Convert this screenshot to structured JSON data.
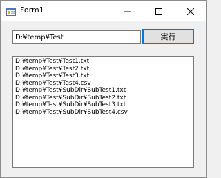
{
  "window": {
    "title": "Form1",
    "icon": "winforms-app-icon",
    "caption_buttons": [
      "minimize-icon",
      "maximize-icon",
      "close-icon"
    ]
  },
  "path_input": {
    "value": "D:¥temp¥Test"
  },
  "run_button": {
    "label": "実行"
  },
  "file_list": {
    "items": [
      "D:¥temp¥Test¥Test1.txt",
      "D:¥temp¥Test¥Test2.txt",
      "D:¥temp¥Test¥Test3.txt",
      "D:¥temp¥Test¥Test4.csv",
      "D:¥temp¥Test¥SubDir¥SubTest1.txt",
      "D:¥temp¥Test¥SubDir¥SubTest2.txt",
      "D:¥temp¥Test¥SubDir¥SubTest3.txt",
      "D:¥temp¥Test¥SubDir¥SubTest4.csv"
    ]
  }
}
